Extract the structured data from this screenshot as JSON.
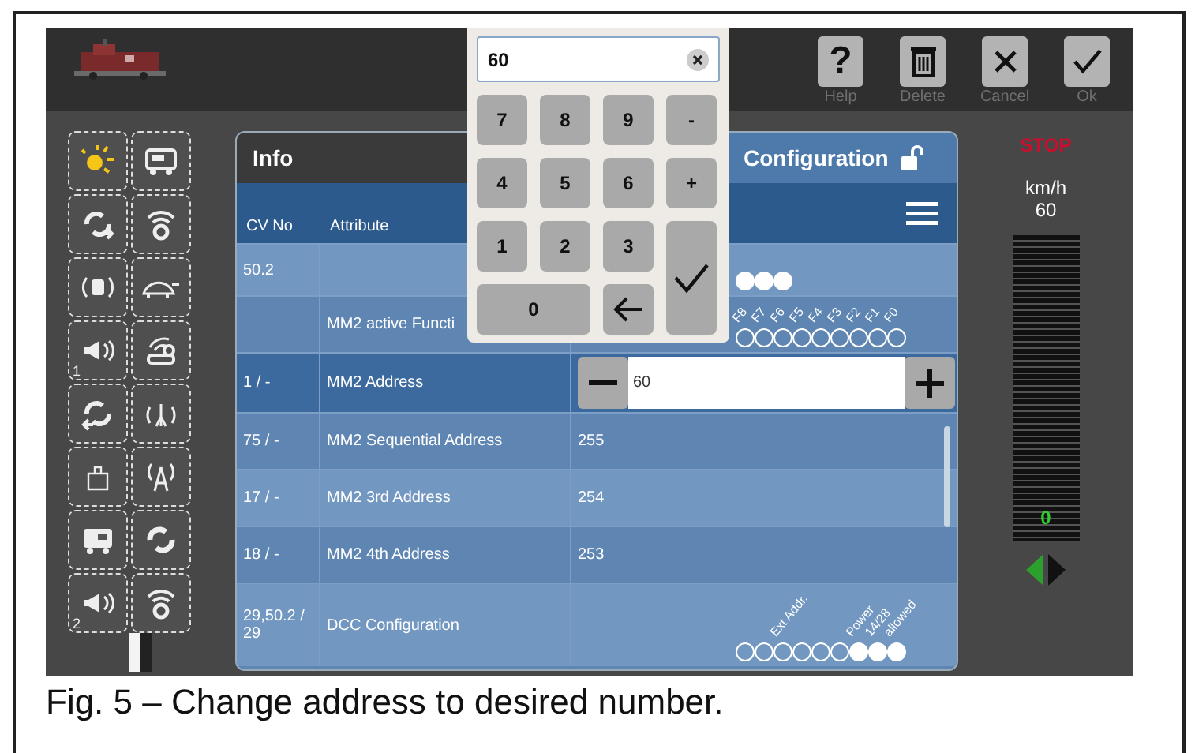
{
  "toolbar": [
    {
      "kind": "help",
      "glyph": "?",
      "label": "Help"
    },
    {
      "kind": "delete",
      "label": "Delete"
    },
    {
      "kind": "cancel",
      "label": "Cancel"
    },
    {
      "kind": "ok",
      "label": "Ok"
    }
  ],
  "functions": [
    {
      "on": true
    },
    {
      "on": false
    },
    {
      "on": false
    },
    {
      "on": false
    },
    {
      "on": false
    },
    {
      "on": false
    },
    {
      "on": false,
      "number": "1"
    },
    {
      "on": false
    },
    {
      "on": false
    },
    {
      "on": false
    },
    {
      "on": false
    },
    {
      "on": false
    },
    {
      "on": false
    },
    {
      "on": false
    },
    {
      "on": false,
      "number": "2"
    },
    {
      "on": false
    }
  ],
  "tabs": [
    {
      "label": "Info",
      "selected": false
    },
    {
      "label": "Configuration",
      "selected": true
    }
  ],
  "table": {
    "columns": [
      "CV No",
      "Attribute"
    ],
    "rows": [
      {
        "kind": "bits",
        "cv": "50.2",
        "selected": false,
        "bits": [
          {
            "on": true
          },
          {
            "on": true
          },
          {
            "on": true
          }
        ]
      },
      {
        "kind": "bits",
        "attribute": "MM2 active Functi",
        "selected": false,
        "bits": [
          {
            "label": "F8",
            "on": false
          },
          {
            "label": "F7",
            "on": false
          },
          {
            "label": "F6",
            "on": false
          },
          {
            "label": "F5",
            "on": false
          },
          {
            "label": "F4",
            "on": false
          },
          {
            "label": "F3",
            "on": false
          },
          {
            "label": "F2",
            "on": false
          },
          {
            "label": "F1",
            "on": false
          },
          {
            "label": "F0",
            "on": false
          }
        ]
      },
      {
        "kind": "stepper",
        "cv": "1 / -",
        "attribute": "MM2 Address",
        "selected": true,
        "value": "60"
      },
      {
        "kind": "value",
        "cv": "75 / -",
        "attribute": "MM2 Sequential Address",
        "selected": false,
        "value": "255"
      },
      {
        "kind": "value",
        "cv": "17 / -",
        "attribute": "MM2 3rd Address",
        "selected": false,
        "value": "254"
      },
      {
        "kind": "value",
        "cv": "18 / -",
        "attribute": "MM2 4th Address",
        "selected": false,
        "value": "253"
      },
      {
        "kind": "bits",
        "cv": "29,50.2 / 29",
        "attribute": "DCC Configuration",
        "selected": false,
        "bits": [
          {
            "on": false
          },
          {
            "on": false
          },
          {
            "label": "Ext Addr.",
            "on": false
          },
          {
            "on": false
          },
          {
            "on": false
          },
          {
            "on": false
          },
          {
            "label": "Power",
            "on": true
          },
          {
            "label": "14/28",
            "on": true
          },
          {
            "label": "allowed",
            "on": true
          }
        ]
      }
    ]
  },
  "speed": {
    "stop": "STOP",
    "unit": "km/h",
    "speed": "60",
    "reading": "0",
    "directions": [
      {
        "selected": true
      },
      {
        "selected": false
      }
    ]
  },
  "keypad": {
    "value": "60",
    "keys": [
      "7",
      "8",
      "9",
      "-",
      "4",
      "5",
      "6",
      "+",
      "1",
      "2",
      "3",
      "0"
    ]
  },
  "caption": "Fig. 5 – Change address to desired number."
}
